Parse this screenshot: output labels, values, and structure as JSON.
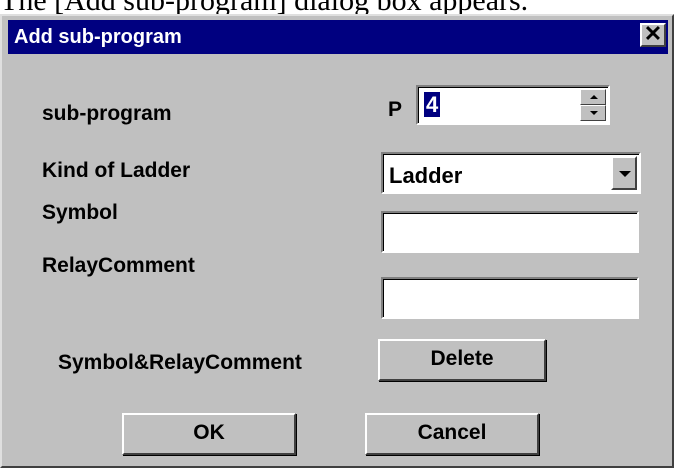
{
  "caption": "The [Add sub-program] dialog box appears.",
  "dialog": {
    "title": "Add sub-program",
    "close_glyph": "✕"
  },
  "subprogram": {
    "label": "sub-program",
    "prefix": "P",
    "value": "4"
  },
  "kind_of_ladder": {
    "label": "Kind of Ladder",
    "selected": "Ladder"
  },
  "symbol": {
    "label": "Symbol",
    "value": ""
  },
  "relay_comment": {
    "label": "RelayComment",
    "value": ""
  },
  "symbol_relay_comment": {
    "label": "Symbol&RelayComment",
    "delete_label": "Delete"
  },
  "buttons": {
    "ok": "OK",
    "cancel": "Cancel"
  },
  "colors": {
    "dialog_face": "#c0c0c0",
    "title_bar": "#000080",
    "selection": "#000080"
  }
}
